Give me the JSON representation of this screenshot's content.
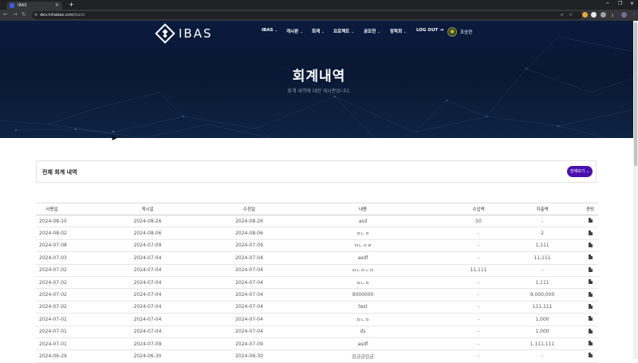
{
  "browser": {
    "tab_title": "IBAS",
    "new_tab": "+",
    "url_host": "dev.inhabas.com",
    "url_path": "/bank",
    "window_controls": [
      "─",
      "❐",
      "✕"
    ]
  },
  "header": {
    "logo_text": "IBAS",
    "menu": [
      {
        "label": "IBAS",
        "dropdown": true
      },
      {
        "label": "게시판",
        "dropdown": true
      },
      {
        "label": "회계",
        "dropdown": true
      },
      {
        "label": "프로젝트",
        "dropdown": true
      },
      {
        "label": "공모전",
        "dropdown": true
      },
      {
        "label": "장학회",
        "dropdown": true
      },
      {
        "label": "LOG OUT",
        "dropdown": false
      }
    ],
    "logout_icon": "logout-icon",
    "username": "조승현"
  },
  "hero": {
    "title": "회계내역",
    "subtitle": "회계 내역에 대한 게시판입니다."
  },
  "section": {
    "title": "전체 회계 내역",
    "view_all_label": "전체보기"
  },
  "table": {
    "headers": [
      "사용일",
      "게시일",
      "수정일",
      "내용",
      "수입액",
      "지출액",
      "증빙"
    ],
    "rows": [
      [
        "2024-08-10",
        "2024-08-26",
        "2024-08-26",
        "asd",
        "50",
        "-"
      ],
      [
        "2024-08-02",
        "2024-08-06",
        "2024-08-06",
        "ㅁㄴㅇ",
        "-",
        "2"
      ],
      [
        "2024-07-08",
        "2024-07-09",
        "2024-07-09",
        "ㅁㄴㅇㄹ",
        "-",
        "1,111"
      ],
      [
        "2024-07-03",
        "2024-07-04",
        "2024-07-04",
        "asdf",
        "-",
        "11,111"
      ],
      [
        "2024-07-02",
        "2024-07-04",
        "2024-07-04",
        "ㅁㄴㅇㄴㅁ",
        "11,111",
        "-"
      ],
      [
        "2024-07-02",
        "2024-07-04",
        "2024-07-04",
        "ㅁㄴㅇ",
        "-",
        "1,111"
      ],
      [
        "2024-07-02",
        "2024-07-04",
        "2024-07-04",
        "9000000",
        "-",
        "9,000,000"
      ],
      [
        "2024-07-02",
        "2024-07-04",
        "2024-07-04",
        "test",
        "-",
        "111,111"
      ],
      [
        "2024-07-01",
        "2024-07-04",
        "2024-07-04",
        "ㅁㄴㅇ",
        "-",
        "1,000"
      ],
      [
        "2024-07-01",
        "2024-07-04",
        "2024-07-04",
        "ds",
        "-",
        "1,000"
      ],
      [
        "2024-07-01",
        "2024-07-09",
        "2024-07-09",
        "asdf",
        "-",
        "1,111,111"
      ],
      [
        "2024-06-29",
        "2024-06-30",
        "2024-06-30",
        "임금금임금",
        "-",
        "-"
      ]
    ]
  },
  "colors": {
    "hero_bg": "#0b1b3d",
    "accent": "#4b0fb0"
  }
}
